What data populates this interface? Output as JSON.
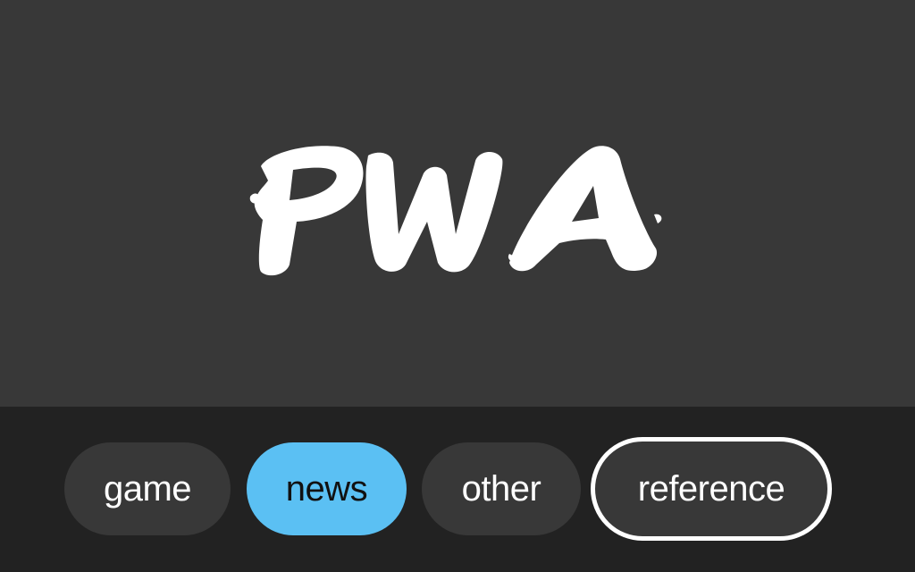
{
  "app": {
    "logo_text": "PWA"
  },
  "theme": {
    "hero_background": "#383838",
    "bar_background": "#222222",
    "chip_background": "#383838",
    "chip_active_background": "#5bc0f3",
    "chip_focus_border": "#ffffff"
  },
  "categories": [
    {
      "label": "game",
      "state": "default"
    },
    {
      "label": "news",
      "state": "selected"
    },
    {
      "label": "other",
      "state": "default"
    },
    {
      "label": "reference",
      "state": "focused"
    }
  ]
}
